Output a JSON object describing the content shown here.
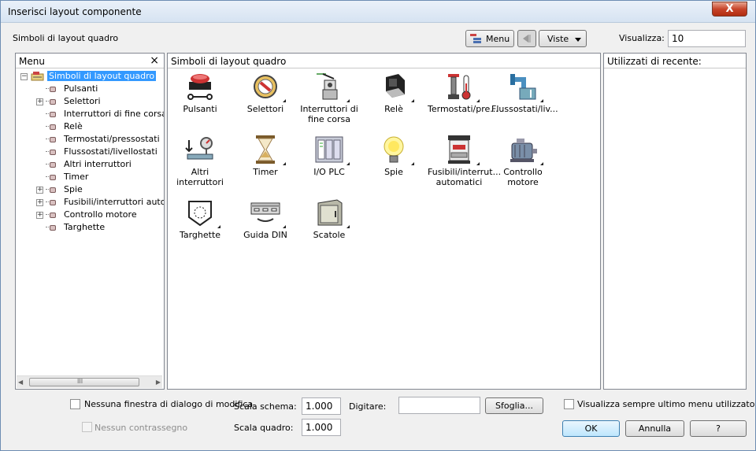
{
  "window": {
    "title": "Inserisci layout componente",
    "close_glyph": "X"
  },
  "toolbar": {
    "section_label": "Simboli di layout quadro",
    "menu_button": "Menu",
    "views_button": "Viste",
    "display_label": "Visualizza:",
    "display_value": "10"
  },
  "menu_panel": {
    "title": "Menu",
    "close_glyph": "×",
    "tree": [
      {
        "label": "Simboli di layout quadro",
        "level": 0,
        "expander": "minus",
        "selected": true
      },
      {
        "label": "Pulsanti",
        "level": 1,
        "expander": "none"
      },
      {
        "label": "Selettori",
        "level": 1,
        "expander": "plus"
      },
      {
        "label": "Interruttori di fine corsa",
        "level": 1,
        "expander": "none"
      },
      {
        "label": "Relè",
        "level": 1,
        "expander": "none"
      },
      {
        "label": "Termostati/pressostati",
        "level": 1,
        "expander": "none"
      },
      {
        "label": "Flussostati/livellostati",
        "level": 1,
        "expander": "none"
      },
      {
        "label": "Altri interruttori",
        "level": 1,
        "expander": "none"
      },
      {
        "label": "Timer",
        "level": 1,
        "expander": "none"
      },
      {
        "label": "Spie",
        "level": 1,
        "expander": "plus"
      },
      {
        "label": "Fusibili/interruttori automati",
        "level": 1,
        "expander": "plus"
      },
      {
        "label": "Controllo motore",
        "level": 1,
        "expander": "plus"
      },
      {
        "label": "Targhette",
        "level": 1,
        "expander": "none"
      }
    ],
    "scroll_grip": "III"
  },
  "symbols_panel": {
    "title": "Simboli di layout quadro",
    "items": [
      {
        "label": "Pulsanti",
        "icon": "pushbutton-icon",
        "submenu": false
      },
      {
        "label": "Selettori",
        "icon": "selector-switch-icon",
        "submenu": true
      },
      {
        "label": "Interruttori di fine corsa",
        "icon": "limit-switch-icon",
        "submenu": true
      },
      {
        "label": "Relè",
        "icon": "relay-icon",
        "submenu": true
      },
      {
        "label": "Termostati/pre...",
        "icon": "thermostat-icon",
        "submenu": true
      },
      {
        "label": "Flussostati/liv...",
        "icon": "flow-switch-icon",
        "submenu": true
      },
      {
        "label": "Altri interruttori",
        "icon": "other-switches-icon",
        "submenu": false
      },
      {
        "label": "Timer",
        "icon": "hourglass-icon",
        "submenu": true
      },
      {
        "label": "I/O PLC",
        "icon": "plc-icon",
        "submenu": true
      },
      {
        "label": "Spie",
        "icon": "lamp-icon",
        "submenu": true
      },
      {
        "label": "Fusibili/interrut... automatici",
        "icon": "fuse-icon",
        "submenu": true
      },
      {
        "label": "Controllo motore",
        "icon": "motor-icon",
        "submenu": true
      },
      {
        "label": "Targhette",
        "icon": "nameplate-icon",
        "submenu": true
      },
      {
        "label": "Guida DIN",
        "icon": "din-rail-icon",
        "submenu": true
      },
      {
        "label": "Scatole",
        "icon": "enclosure-icon",
        "submenu": true
      }
    ]
  },
  "recent_panel": {
    "title": "Utilizzati di recente:"
  },
  "footer": {
    "no_edit_dialog": "Nessuna finestra di dialogo di modifica",
    "no_tag": "Nessun contrassegno",
    "schematic_scale_label": "Scala schema:",
    "schematic_scale_value": "1.000",
    "panel_scale_label": "Scala quadro:",
    "panel_scale_value": "1.000",
    "type_label": "Digitare:",
    "type_value": "",
    "browse_button": "Sfoglia...",
    "always_show_last": "Visualizza sempre ultimo menu utilizzato",
    "ok_button": "OK",
    "cancel_button": "Annulla",
    "help_button": "?"
  },
  "colors": {
    "selection": "#3399ff",
    "title_gradient": "#d6e3f2",
    "close": "#c7452b"
  }
}
